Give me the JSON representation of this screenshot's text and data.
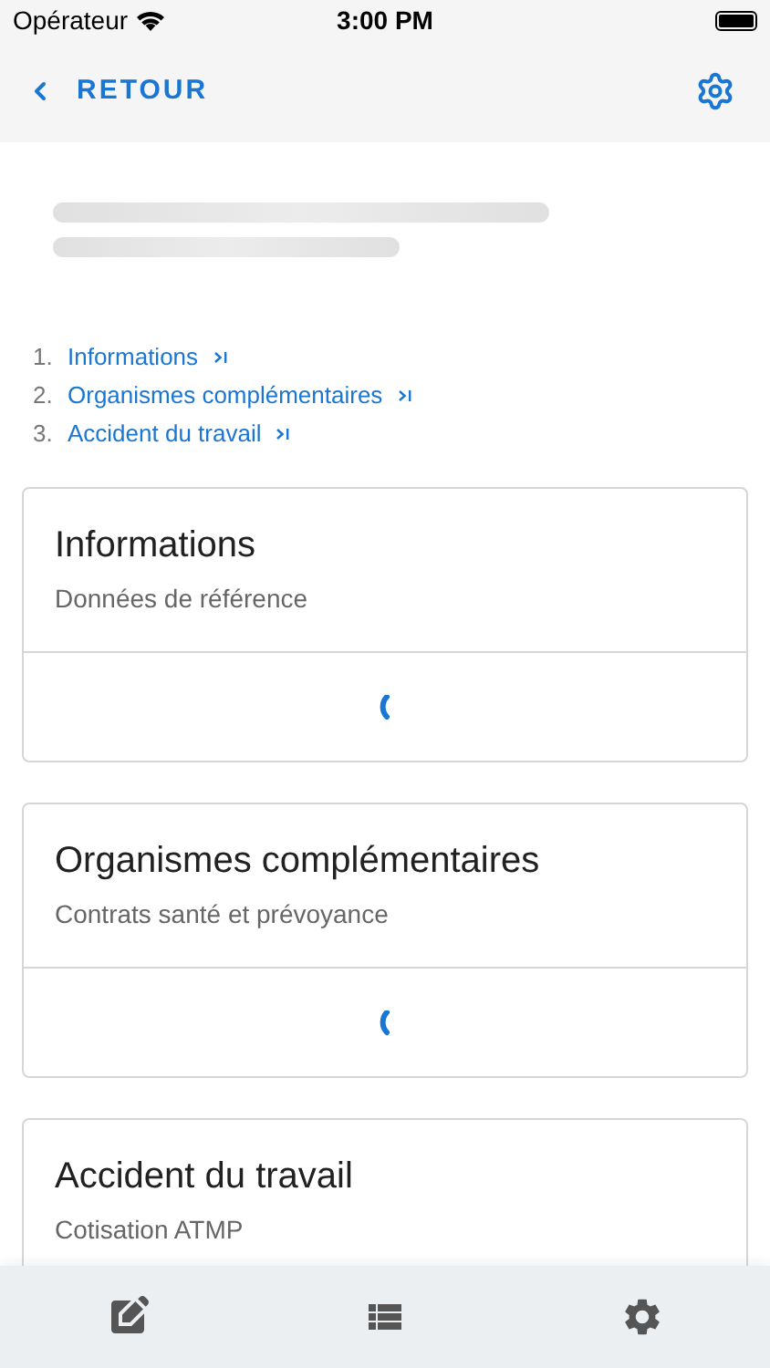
{
  "status_bar": {
    "carrier": "Opérateur",
    "time": "3:00 PM"
  },
  "header": {
    "back_label": "RETOUR"
  },
  "toc": [
    {
      "number": "1.",
      "label": "Informations"
    },
    {
      "number": "2.",
      "label": "Organismes complémentaires"
    },
    {
      "number": "3.",
      "label": "Accident du travail"
    }
  ],
  "cards": [
    {
      "title": "Informations",
      "subtitle": "Données de référence",
      "loading": true
    },
    {
      "title": "Organismes complémentaires",
      "subtitle": "Contrats santé et prévoyance",
      "loading": true
    },
    {
      "title": "Accident du travail",
      "subtitle": "Cotisation ATMP",
      "loading": false
    }
  ],
  "tab_bar": [
    {
      "kind": "edit"
    },
    {
      "kind": "list"
    },
    {
      "kind": "settings"
    }
  ]
}
